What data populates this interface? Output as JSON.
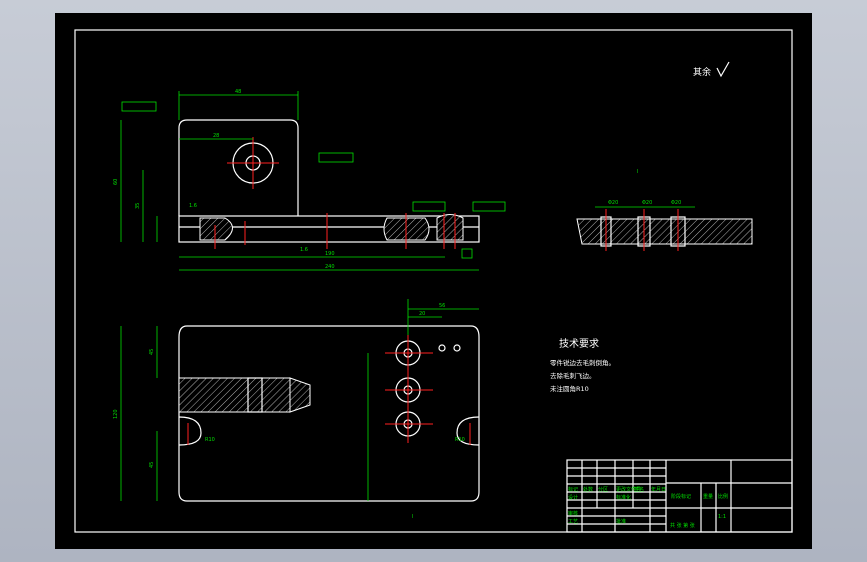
{
  "drawing": {
    "roughness_note": "其余",
    "section_label": "I",
    "tech_req": {
      "title": "技术要求",
      "items": [
        "零件锐边去毛刺倒角。",
        "去除毛刺飞边。",
        "未注圆角R10"
      ]
    },
    "dims": {
      "top_width": "48",
      "hole_pos": "28",
      "overall_len": "240",
      "lower_len": "190",
      "height_left": "35",
      "height_total": "60",
      "roughness_top": "1.6",
      "roughness_mid": "1.6",
      "section_w1": "Φ20",
      "section_w2": "Φ20",
      "section_w3": "Φ20",
      "plan_height": "120",
      "plan_width": "56",
      "plan_w2": "20",
      "plan_d1": "45",
      "plan_d2": "45",
      "plan_s1": "R10",
      "plan_s2": "R10"
    },
    "title_block": {
      "row_labels": [
        "标记",
        "处数",
        "分区",
        "更改文件号",
        "签名",
        "年月日"
      ],
      "stage": "阶段标记",
      "weight": "重量",
      "scale": "比例",
      "scale_value": "1:1",
      "sheet_info": "共 张 第 张",
      "designer": "设计",
      "checker": "审核",
      "process": "工艺",
      "standard": "标准化",
      "approve": "批准"
    }
  }
}
